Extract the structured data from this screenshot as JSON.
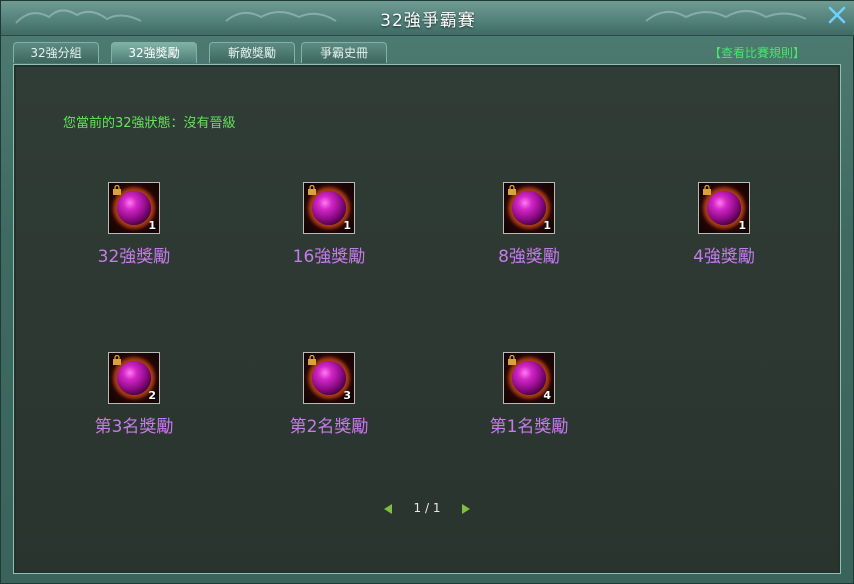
{
  "window": {
    "title": "32強爭霸賽"
  },
  "tabs": [
    {
      "label": "32強分組"
    },
    {
      "label": "32強獎勵"
    },
    {
      "label": "斬敵獎勵"
    },
    {
      "label": "爭霸史冊"
    }
  ],
  "active_tab": 1,
  "rules_link": "【查看比賽規則】",
  "status_text": "您當前的32強狀態：沒有晉級",
  "rewards": [
    {
      "label": "32強獎勵",
      "count": "1",
      "icon": "purple-orb-icon"
    },
    {
      "label": "16強獎勵",
      "count": "1",
      "icon": "purple-orb-icon"
    },
    {
      "label": "8強獎勵",
      "count": "1",
      "icon": "purple-orb-icon"
    },
    {
      "label": "4強獎勵",
      "count": "1",
      "icon": "purple-orb-icon"
    },
    {
      "label": "第3名獎勵",
      "count": "2",
      "icon": "purple-orb-icon"
    },
    {
      "label": "第2名獎勵",
      "count": "3",
      "icon": "purple-orb-icon"
    },
    {
      "label": "第1名獎勵",
      "count": "4",
      "icon": "purple-orb-icon"
    }
  ],
  "pager": {
    "text": "1 / 1"
  },
  "colors": {
    "accent_green": "#66e25c",
    "reward_label": "#c57be8",
    "link": "#44e86a"
  }
}
